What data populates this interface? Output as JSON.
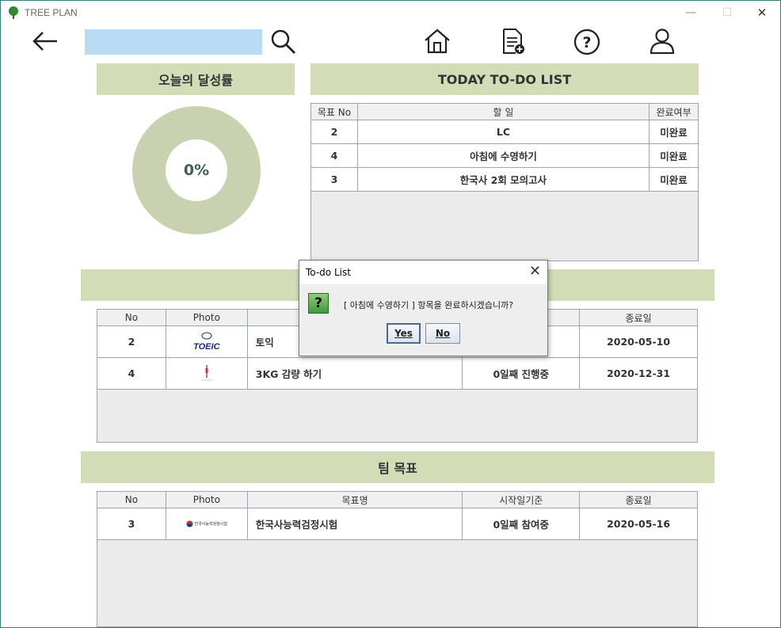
{
  "window": {
    "title": "TREE PLAN",
    "controls": {
      "minimize": "—",
      "maximize": "☐",
      "close": "✕"
    }
  },
  "toolbar": {
    "search_value": ""
  },
  "achievement": {
    "title": "오늘의 달성률",
    "percent_label": "0%",
    "ring_color": "#c9d2b0"
  },
  "todo": {
    "title": "TODAY TO-DO LIST",
    "headers": [
      "목표 No",
      "할 일",
      "완료여부"
    ],
    "rows": [
      {
        "no": "2",
        "task": "LC",
        "status": "미완료"
      },
      {
        "no": "4",
        "task": "아침에 수영하기",
        "status": "미완료"
      },
      {
        "no": "3",
        "task": "한국사 2회 모의고사",
        "status": "미완료"
      }
    ]
  },
  "personal_goals": {
    "title": "",
    "headers": [
      "No",
      "Photo",
      "",
      "",
      "종료일"
    ],
    "rows": [
      {
        "no": "2",
        "photo": "TOEIC",
        "name": "토익",
        "progress": "",
        "end": "2020-05-10"
      },
      {
        "no": "4",
        "photo": "",
        "name": "3KG 감량 하기",
        "progress": "0일째 진행중",
        "end": "2020-12-31"
      }
    ]
  },
  "team_goals": {
    "title": "팀 목표",
    "headers": [
      "No",
      "Photo",
      "목표명",
      "시작일기준",
      "종료일"
    ],
    "rows": [
      {
        "no": "3",
        "photo": "한국사능력검정시험",
        "name": "한국사능력검정시험",
        "progress": "0일째 참여중",
        "end": "2020-05-16"
      }
    ]
  },
  "dialog": {
    "title": "To-do List",
    "close": "✕",
    "icon": "?",
    "message": "[ 아침에 수영하기 ] 항목을 완료하시겠습니까?",
    "yes": "Yes",
    "no": "No"
  },
  "colors": {
    "section_bg": "#d2ddb8",
    "search_bg": "#b9dcf4",
    "window_border": "#3c7a76"
  }
}
